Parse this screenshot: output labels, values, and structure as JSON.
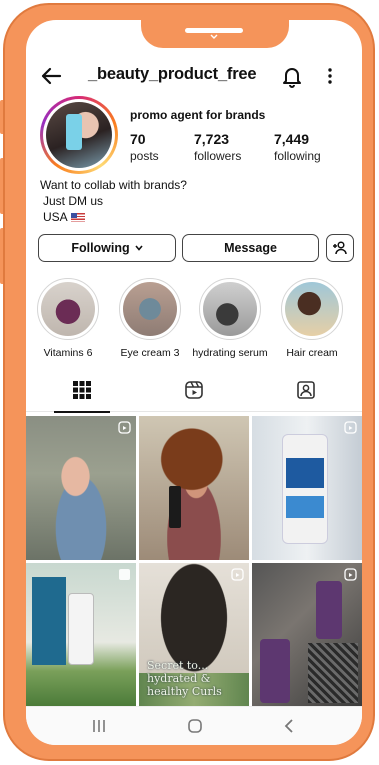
{
  "profile": {
    "username": "_beauty_product_free",
    "bio_title": "promo agent for brands",
    "stats": [
      {
        "value": "70",
        "label": "posts"
      },
      {
        "value": "7,723",
        "label": "followers"
      },
      {
        "value": "7,449",
        "label": "following"
      }
    ],
    "bio_lines": [
      "Want to collab with brands?",
      "Just DM us",
      "USA"
    ]
  },
  "actions": {
    "following_label": "Following",
    "message_label": "Message"
  },
  "highlights": [
    {
      "label": "Vitamins 6"
    },
    {
      "label": "Eye cream 3"
    },
    {
      "label": "hydrating serum"
    },
    {
      "label": "Hair cream"
    }
  ],
  "grid": {
    "post5_text": "Secret to... hydrated & healthy Curls"
  },
  "icons": {
    "back": "back-arrow-icon",
    "bell": "bell-icon",
    "more": "more-vertical-icon",
    "add_user": "add-user-icon",
    "grid_tab": "grid-icon",
    "reels_tab": "reels-icon",
    "tagged_tab": "tagged-icon"
  },
  "colors": {
    "frame": "#f5945a",
    "story_ring_start": "#d62976",
    "story_ring_end": "#feda75"
  }
}
